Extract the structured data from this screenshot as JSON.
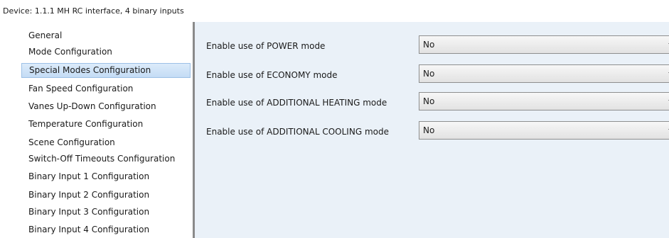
{
  "title": "Device: 1.1.1  MH RC interface, 4 binary inputs",
  "sidebar": {
    "items": [
      {
        "label": "General"
      },
      {
        "label": "Mode Configuration"
      },
      {
        "label": "Special Modes Configuration",
        "selected": true
      },
      {
        "label": "Fan Speed Configuration"
      },
      {
        "label": "Vanes Up-Down Configuration"
      },
      {
        "label": "Temperature Configuration"
      },
      {
        "label": "Scene Configuration"
      },
      {
        "label": "Switch-Off Timeouts Configuration"
      },
      {
        "label": "Binary Input 1 Configuration"
      },
      {
        "label": "Binary Input 2 Configuration"
      },
      {
        "label": "Binary Input 3 Configuration"
      },
      {
        "label": "Binary Input 4 Configuration"
      }
    ]
  },
  "settings": [
    {
      "label": "Enable use of POWER mode",
      "value": "No"
    },
    {
      "label": "Enable use of ECONOMY mode",
      "value": "No"
    },
    {
      "label": "Enable use of ADDITIONAL HEATING mode",
      "value": "No"
    },
    {
      "label": "Enable use of ADDITIONAL COOLING mode",
      "value": "No"
    }
  ],
  "colors": {
    "panel_background": "#eaf1f8",
    "selected_item": "#c4dcf5",
    "divider": "#8a8a8a"
  }
}
